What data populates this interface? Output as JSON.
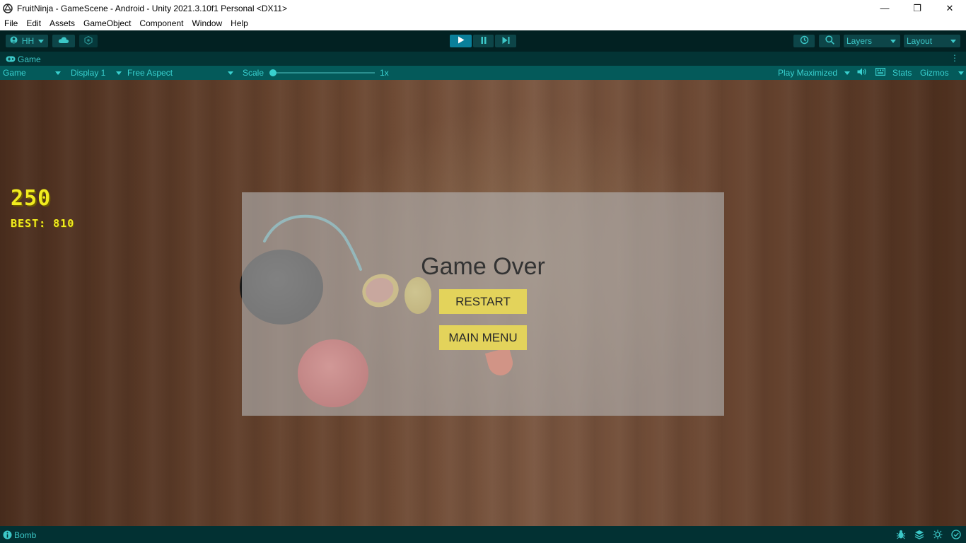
{
  "window": {
    "title": "FruitNinja - GameScene - Android - Unity 2021.3.10f1 Personal <DX11>",
    "minimize": "—",
    "maximize": "❐",
    "close": "✕"
  },
  "menu": [
    "File",
    "Edit",
    "Assets",
    "GameObject",
    "Component",
    "Window",
    "Help"
  ],
  "toolbar": {
    "account": "HH",
    "layers": "Layers",
    "layout": "Layout",
    "playing": true
  },
  "tab": {
    "label": "Game"
  },
  "gamebar": {
    "view": "Game",
    "display": "Display 1",
    "aspect": "Free Aspect",
    "scale_label": "Scale",
    "scale_value": "1x",
    "play_mode": "Play Maximized",
    "stats": "Stats",
    "gizmos": "Gizmos"
  },
  "game": {
    "score": "250",
    "best": "BEST: 810",
    "panel_title": "Game Over",
    "restart": "RESTART",
    "main_menu": "MAIN MENU"
  },
  "status": {
    "message": "Bomb"
  },
  "colors": {
    "accent": "#3cc8c8",
    "score_yellow": "#f1ec1f",
    "button_yellow": "#e3d35b"
  }
}
